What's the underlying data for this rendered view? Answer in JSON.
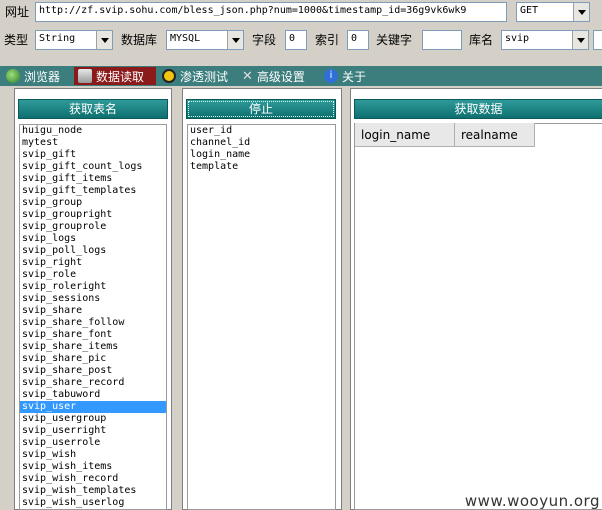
{
  "row1": {
    "url_label": "网址",
    "url_value": "http://zf.svip.sohu.com/bless_json.php?num=1000&timestamp_id=36g9vk6wk9",
    "method_value": "GET"
  },
  "row2": {
    "type_label": "类型",
    "type_value": "String",
    "db_label": "数据库",
    "db_value": "MYSQL",
    "field_label": "字段",
    "field_value": "0",
    "index_label": "索引",
    "index_value": "0",
    "keyword_label": "关键字",
    "keyword_value": "",
    "dbname_label": "库名",
    "dbname_value": "svip"
  },
  "tabs": [
    {
      "label": "浏览器",
      "icon": "globe-icon"
    },
    {
      "label": "数据读取",
      "icon": "database-icon"
    },
    {
      "label": "渗透测试",
      "icon": "radiation-icon"
    },
    {
      "label": "高级设置",
      "icon": "tools-icon"
    },
    {
      "label": "关于",
      "icon": "info-icon"
    }
  ],
  "left_panel": {
    "button": "获取表名",
    "tables": [
      "huigu_node",
      "mytest",
      "svip_gift",
      "svip_gift_count_logs",
      "svip_gift_items",
      "svip_gift_templates",
      "svip_group",
      "svip_groupright",
      "svip_grouprole",
      "svip_logs",
      "svip_poll_logs",
      "svip_right",
      "svip_role",
      "svip_roleright",
      "svip_sessions",
      "svip_share",
      "svip_share_follow",
      "svip_share_font",
      "svip_share_items",
      "svip_share_pic",
      "svip_share_post",
      "svip_share_record",
      "svip_tabuword",
      "svip_user",
      "svip_usergroup",
      "svip_userright",
      "svip_userrole",
      "svip_wish",
      "svip_wish_items",
      "svip_wish_record",
      "svip_wish_templates",
      "svip_wish_userlog"
    ],
    "selected": "svip_user"
  },
  "mid_panel": {
    "button": "停止",
    "columns": [
      "user_id",
      "channel_id",
      "login_name",
      "template"
    ]
  },
  "right_panel": {
    "button": "获取数据",
    "grid_headers": [
      "login_name",
      "realname"
    ]
  },
  "watermark": "www.wooyun.org"
}
